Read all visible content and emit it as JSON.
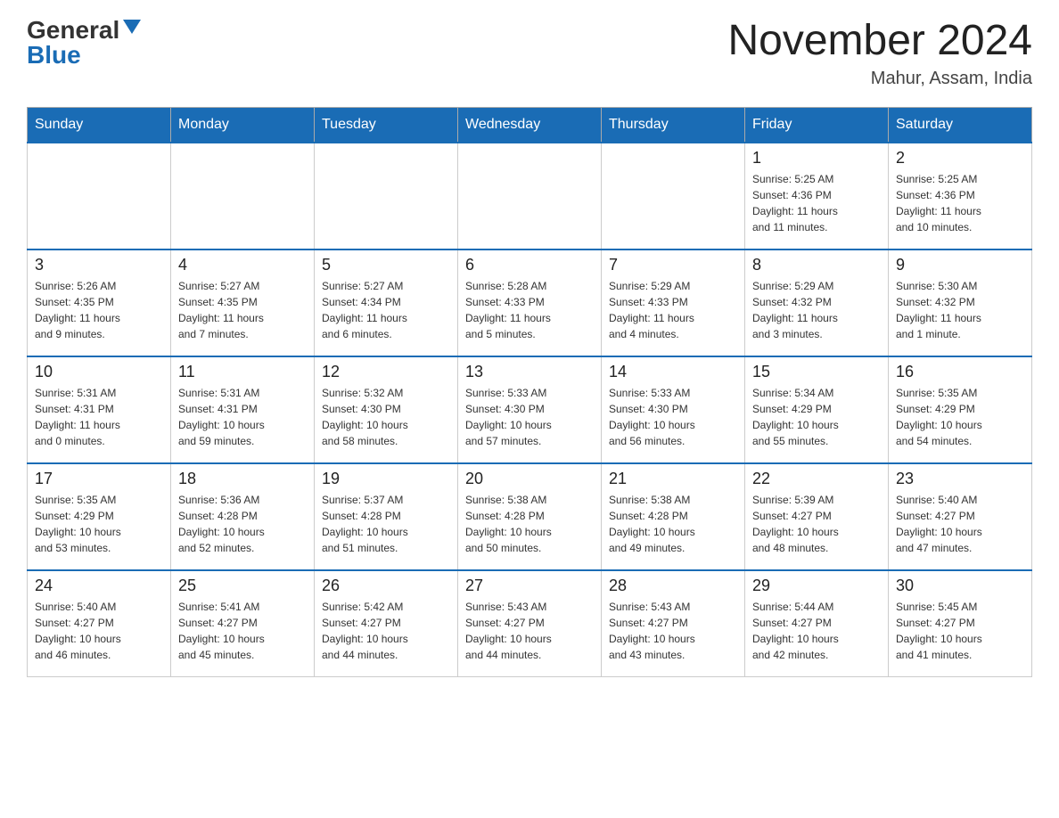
{
  "header": {
    "logo_general": "General",
    "logo_blue": "Blue",
    "month_year": "November 2024",
    "location": "Mahur, Assam, India"
  },
  "days_of_week": [
    "Sunday",
    "Monday",
    "Tuesday",
    "Wednesday",
    "Thursday",
    "Friday",
    "Saturday"
  ],
  "weeks": [
    [
      {
        "day": "",
        "info": ""
      },
      {
        "day": "",
        "info": ""
      },
      {
        "day": "",
        "info": ""
      },
      {
        "day": "",
        "info": ""
      },
      {
        "day": "",
        "info": ""
      },
      {
        "day": "1",
        "info": "Sunrise: 5:25 AM\nSunset: 4:36 PM\nDaylight: 11 hours\nand 11 minutes."
      },
      {
        "day": "2",
        "info": "Sunrise: 5:25 AM\nSunset: 4:36 PM\nDaylight: 11 hours\nand 10 minutes."
      }
    ],
    [
      {
        "day": "3",
        "info": "Sunrise: 5:26 AM\nSunset: 4:35 PM\nDaylight: 11 hours\nand 9 minutes."
      },
      {
        "day": "4",
        "info": "Sunrise: 5:27 AM\nSunset: 4:35 PM\nDaylight: 11 hours\nand 7 minutes."
      },
      {
        "day": "5",
        "info": "Sunrise: 5:27 AM\nSunset: 4:34 PM\nDaylight: 11 hours\nand 6 minutes."
      },
      {
        "day": "6",
        "info": "Sunrise: 5:28 AM\nSunset: 4:33 PM\nDaylight: 11 hours\nand 5 minutes."
      },
      {
        "day": "7",
        "info": "Sunrise: 5:29 AM\nSunset: 4:33 PM\nDaylight: 11 hours\nand 4 minutes."
      },
      {
        "day": "8",
        "info": "Sunrise: 5:29 AM\nSunset: 4:32 PM\nDaylight: 11 hours\nand 3 minutes."
      },
      {
        "day": "9",
        "info": "Sunrise: 5:30 AM\nSunset: 4:32 PM\nDaylight: 11 hours\nand 1 minute."
      }
    ],
    [
      {
        "day": "10",
        "info": "Sunrise: 5:31 AM\nSunset: 4:31 PM\nDaylight: 11 hours\nand 0 minutes."
      },
      {
        "day": "11",
        "info": "Sunrise: 5:31 AM\nSunset: 4:31 PM\nDaylight: 10 hours\nand 59 minutes."
      },
      {
        "day": "12",
        "info": "Sunrise: 5:32 AM\nSunset: 4:30 PM\nDaylight: 10 hours\nand 58 minutes."
      },
      {
        "day": "13",
        "info": "Sunrise: 5:33 AM\nSunset: 4:30 PM\nDaylight: 10 hours\nand 57 minutes."
      },
      {
        "day": "14",
        "info": "Sunrise: 5:33 AM\nSunset: 4:30 PM\nDaylight: 10 hours\nand 56 minutes."
      },
      {
        "day": "15",
        "info": "Sunrise: 5:34 AM\nSunset: 4:29 PM\nDaylight: 10 hours\nand 55 minutes."
      },
      {
        "day": "16",
        "info": "Sunrise: 5:35 AM\nSunset: 4:29 PM\nDaylight: 10 hours\nand 54 minutes."
      }
    ],
    [
      {
        "day": "17",
        "info": "Sunrise: 5:35 AM\nSunset: 4:29 PM\nDaylight: 10 hours\nand 53 minutes."
      },
      {
        "day": "18",
        "info": "Sunrise: 5:36 AM\nSunset: 4:28 PM\nDaylight: 10 hours\nand 52 minutes."
      },
      {
        "day": "19",
        "info": "Sunrise: 5:37 AM\nSunset: 4:28 PM\nDaylight: 10 hours\nand 51 minutes."
      },
      {
        "day": "20",
        "info": "Sunrise: 5:38 AM\nSunset: 4:28 PM\nDaylight: 10 hours\nand 50 minutes."
      },
      {
        "day": "21",
        "info": "Sunrise: 5:38 AM\nSunset: 4:28 PM\nDaylight: 10 hours\nand 49 minutes."
      },
      {
        "day": "22",
        "info": "Sunrise: 5:39 AM\nSunset: 4:27 PM\nDaylight: 10 hours\nand 48 minutes."
      },
      {
        "day": "23",
        "info": "Sunrise: 5:40 AM\nSunset: 4:27 PM\nDaylight: 10 hours\nand 47 minutes."
      }
    ],
    [
      {
        "day": "24",
        "info": "Sunrise: 5:40 AM\nSunset: 4:27 PM\nDaylight: 10 hours\nand 46 minutes."
      },
      {
        "day": "25",
        "info": "Sunrise: 5:41 AM\nSunset: 4:27 PM\nDaylight: 10 hours\nand 45 minutes."
      },
      {
        "day": "26",
        "info": "Sunrise: 5:42 AM\nSunset: 4:27 PM\nDaylight: 10 hours\nand 44 minutes."
      },
      {
        "day": "27",
        "info": "Sunrise: 5:43 AM\nSunset: 4:27 PM\nDaylight: 10 hours\nand 44 minutes."
      },
      {
        "day": "28",
        "info": "Sunrise: 5:43 AM\nSunset: 4:27 PM\nDaylight: 10 hours\nand 43 minutes."
      },
      {
        "day": "29",
        "info": "Sunrise: 5:44 AM\nSunset: 4:27 PM\nDaylight: 10 hours\nand 42 minutes."
      },
      {
        "day": "30",
        "info": "Sunrise: 5:45 AM\nSunset: 4:27 PM\nDaylight: 10 hours\nand 41 minutes."
      }
    ]
  ]
}
